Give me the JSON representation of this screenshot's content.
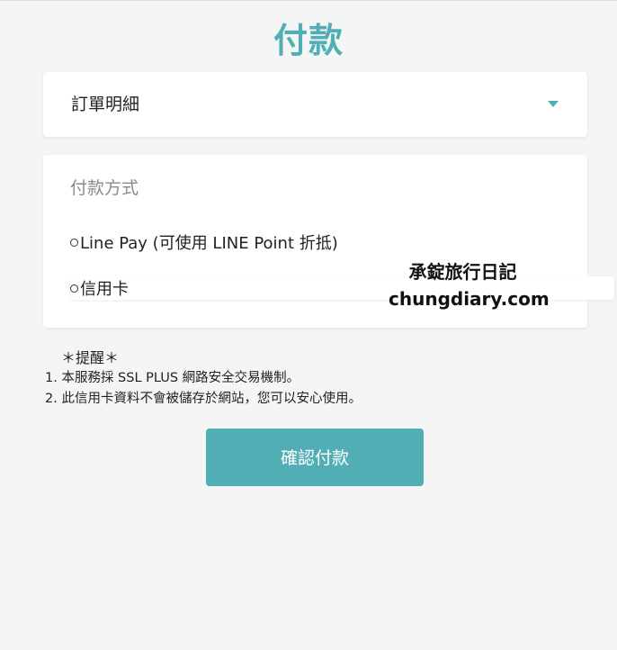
{
  "page": {
    "title": "付款"
  },
  "order": {
    "label": "訂單明細"
  },
  "payment": {
    "heading": "付款方式",
    "options": [
      {
        "label": "Line Pay (可使用 LINE Point 折抵)",
        "selected": false
      },
      {
        "label": "信用卡",
        "selected": false
      }
    ]
  },
  "watermark": {
    "line1": "承錠旅行日記",
    "line2": "chungdiary.com"
  },
  "notes": {
    "title": "＊提醒＊",
    "items": [
      "1. 本服務採 SSL PLUS 網路安全交易機制。",
      "2. 此信用卡資料不會被儲存於網站，您可以安心使用。"
    ]
  },
  "actions": {
    "confirm_label": "確認付款"
  },
  "colors": {
    "accent": "#52aeb5",
    "background": "#f4f5f5"
  }
}
